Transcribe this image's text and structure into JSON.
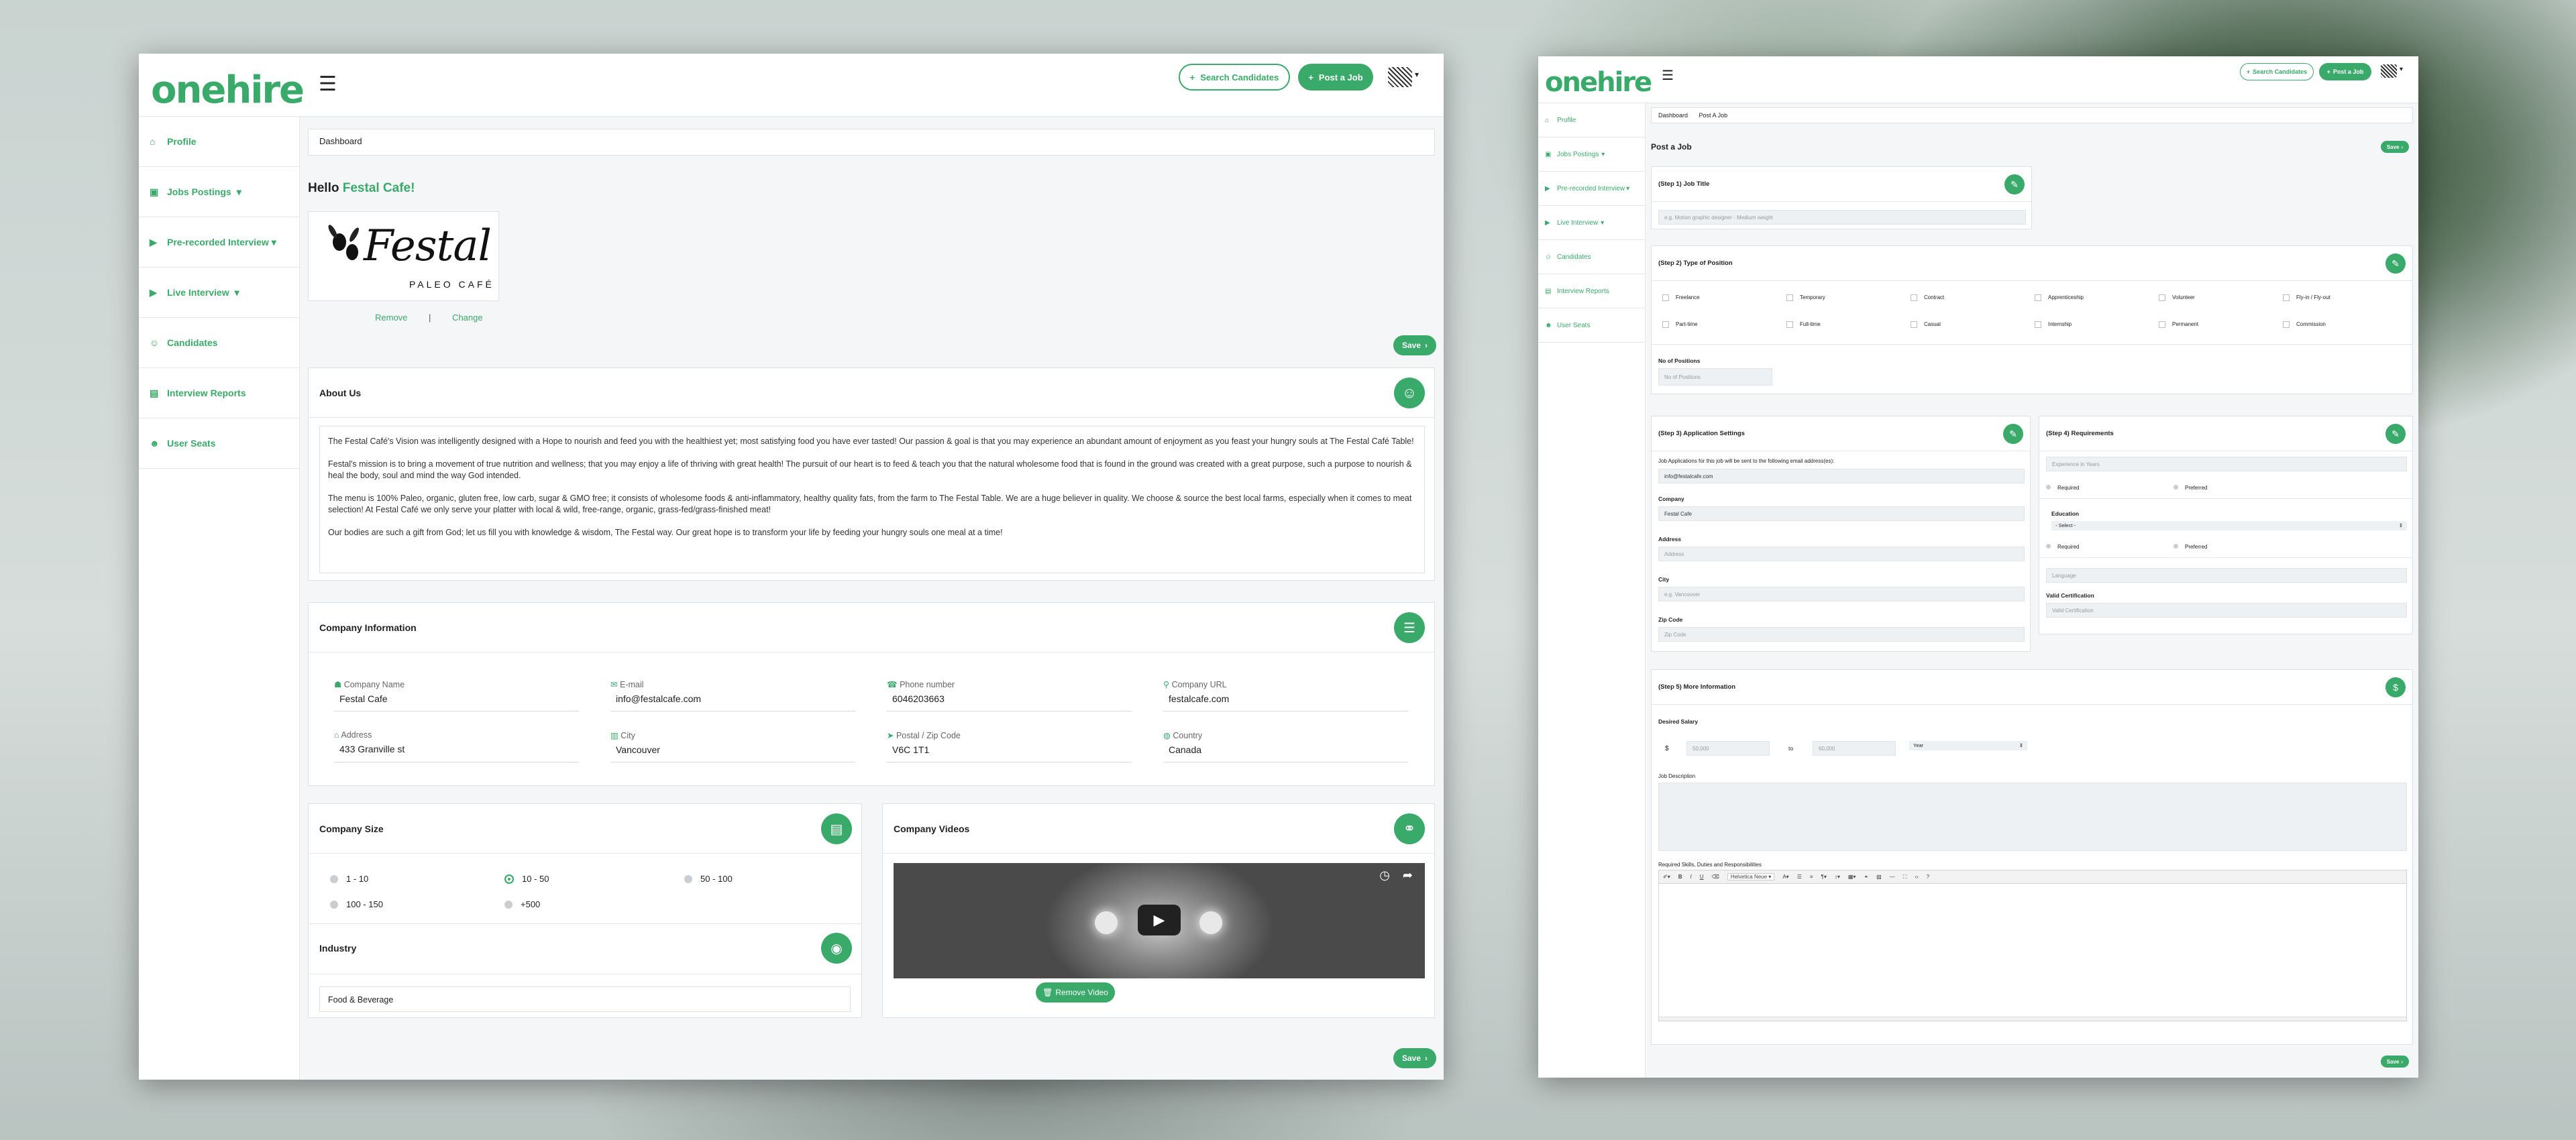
{
  "left": {
    "brand": "onehire",
    "header": {
      "search_label": "Search Candidates",
      "post_label": "Post a Job"
    },
    "sidebar": [
      {
        "icon": "home-icon",
        "label": "Profile",
        "glyph": "⌂"
      },
      {
        "icon": "briefcase-icon",
        "label": "Jobs Postings",
        "glyph": "▣",
        "caret": "▾"
      },
      {
        "icon": "video-icon",
        "label": "Pre-recorded Interview",
        "glyph": "▶",
        "caret": "▾"
      },
      {
        "icon": "live-icon",
        "label": "Live Interview",
        "glyph": "▶",
        "caret": "▾"
      },
      {
        "icon": "users-icon",
        "label": "Candidates",
        "glyph": "☺"
      },
      {
        "icon": "report-icon",
        "label": "Interview Reports",
        "glyph": "▤"
      },
      {
        "icon": "user-seats-icon",
        "label": "User Seats",
        "glyph": "☻"
      }
    ],
    "breadcrumb": "Dashboard",
    "greeting": {
      "prefix": "Hello",
      "name": "Festal Cafe!"
    },
    "company_logo": {
      "name": "Festal",
      "sub": "PALEO CAFÉ"
    },
    "logo_actions": {
      "remove": "Remove",
      "sep": "|",
      "change": "Change"
    },
    "save_label": "Save",
    "about": {
      "title": "About Us",
      "paragraphs": [
        " The Festal Café's Vision was intelligently designed with a Hope to nourish and feed you with the healthiest yet; most satisfying food you have ever tasted! Our passion & goal is that you may experience an abundant amount of enjoyment as you feast your hungry souls at The Festal Café Table!",
        "Festal's mission is to bring a movement of true nutrition and wellness; that you may enjoy a life of thriving with great health! The pursuit of our heart is to feed & teach you that the natural wholesome food that is found in the ground was created with a great purpose, such a purpose to nourish & heal the body, soul and mind the way God intended.",
        "The menu is 100% Paleo, organic, gluten free, low carb, sugar & GMO free; it consists of wholesome foods & anti-inflammatory, healthy quality fats, from the farm to The Festal Table. We are a huge believer in quality. We choose & source the best local farms, especially when it comes to meat selection! At Festal Café we only serve your platter with local & wild, free-range, organic, grass-fed/grass-finished meat!",
        "Our bodies are such a gift from God; let us fill you with knowledge & wisdom, The Festal way. Our great hope is to transform your life by feeding your hungry souls one meal at a time!"
      ]
    },
    "company_info": {
      "title": "Company Information",
      "fields": [
        {
          "label": "Company Name",
          "value": "Festal Cafe",
          "glyph": "☗"
        },
        {
          "label": "E-mail",
          "value": "info@festalcafe.com",
          "glyph": "✉"
        },
        {
          "label": "Phone number",
          "value": "6046203663",
          "glyph": "☎"
        },
        {
          "label": "Company URL",
          "value": "festalcafe.com",
          "glyph": "⚲"
        },
        {
          "label": "Address",
          "value": "433 Granville st",
          "glyph": "⌂"
        },
        {
          "label": "City",
          "value": "Vancouver",
          "glyph": "▥"
        },
        {
          "label": "Postal / Zip Code",
          "value": "V6C 1T1",
          "glyph": "➤"
        },
        {
          "label": "Country",
          "value": "Canada",
          "glyph": "◍"
        }
      ]
    },
    "company_size": {
      "title": "Company Size",
      "options": [
        "1 - 10",
        "10 - 50",
        "50 - 100",
        "100 - 150",
        "+500"
      ],
      "selected": "10 - 50"
    },
    "industry": {
      "title": "Industry",
      "value": "Food & Beverage"
    },
    "videos": {
      "title": "Company Videos",
      "remove_label": "Remove Video"
    }
  },
  "right": {
    "brand": "onehire",
    "header": {
      "search_label": "Search Candidates",
      "post_label": "Post a Job"
    },
    "sidebar": [
      {
        "icon": "home-icon",
        "label": "Profile"
      },
      {
        "icon": "briefcase-icon",
        "label": "Jobs Postings",
        "caret": "▾"
      },
      {
        "icon": "video-icon",
        "label": "Pre-recorded Interview",
        "caret": "▾"
      },
      {
        "icon": "live-icon",
        "label": "Live Interview",
        "caret": "▾"
      },
      {
        "icon": "users-icon",
        "label": "Candidates"
      },
      {
        "icon": "report-icon",
        "label": "Interview Reports"
      },
      {
        "icon": "user-seats-icon",
        "label": "User Seats"
      }
    ],
    "breadcrumb": [
      "Dashboard",
      "Post A Job"
    ],
    "page_title": "Post a Job",
    "save_label": "Save",
    "step1": {
      "title": "(Step 1) Job Title",
      "placeholder": "e.g. Motion graphic designer - Medium weight"
    },
    "step2": {
      "title": "(Step 2) Type of Position",
      "types": [
        "Freelance",
        "Temporary",
        "Contract",
        "Apprenticeship",
        "Volunteer",
        "Fly-in / Fly-out",
        "Part-time",
        "Full-time",
        "Casual",
        "Internship",
        "Permanent",
        "Commission"
      ],
      "positions_label": "No of Positions",
      "positions_placeholder": "No of Positions"
    },
    "step3": {
      "title": "(Step 3) Application Settings",
      "email_label": "Job Applications for this job will be sent to the following email address(es):",
      "email_value": "info@festalcafe.com",
      "company_label": "Company",
      "company_value": "Festal Cafe",
      "address_label": "Address",
      "address_placeholder": "Address",
      "city_label": "City",
      "city_placeholder": "e.g. Vancouver",
      "zip_label": "Zip Code",
      "zip_placeholder": "Zip Code"
    },
    "step4": {
      "title": "(Step 4) Requirements",
      "experience_placeholder": "Experience in Years",
      "required": "Required",
      "preferred": "Preferred",
      "education_label": "Education",
      "education_value": "- Select -",
      "language_placeholder": "Language",
      "cert_label": "Valid Certification",
      "cert_placeholder": "Valid Certification"
    },
    "step5": {
      "title": "(Step 5) More Information",
      "salary_label": "Desired Salary",
      "currency": "$",
      "min_placeholder": "50,000",
      "to": "to",
      "max_placeholder": "60,000",
      "period": "Year",
      "desc_label": "Job Description",
      "skills_label": "Required Skills, Duties and Responsibilities",
      "font_name": "Helvetica Neue"
    }
  }
}
